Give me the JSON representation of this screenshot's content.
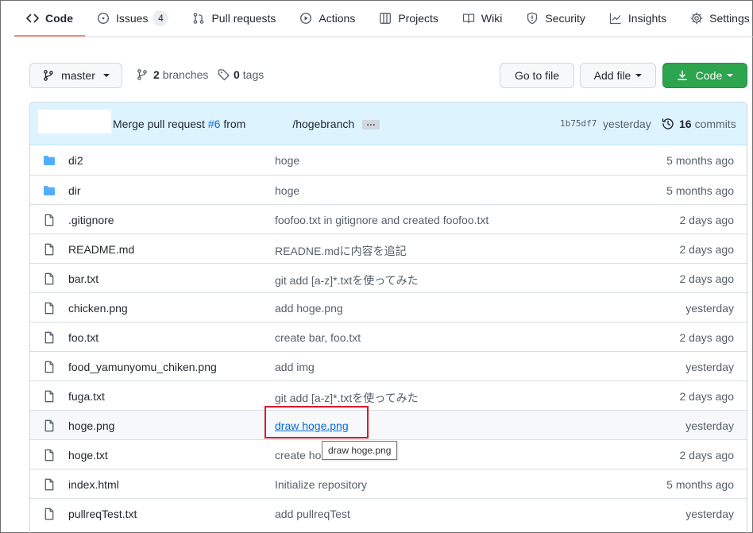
{
  "nav": {
    "tabs": [
      {
        "label": "Code",
        "icon": "code-icon",
        "active": true
      },
      {
        "label": "Issues",
        "icon": "issue-opened-icon",
        "count": "4"
      },
      {
        "label": "Pull requests",
        "icon": "git-pull-request-icon"
      },
      {
        "label": "Actions",
        "icon": "play-icon"
      },
      {
        "label": "Projects",
        "icon": "table-icon"
      },
      {
        "label": "Wiki",
        "icon": "book-icon"
      },
      {
        "label": "Security",
        "icon": "shield-icon"
      },
      {
        "label": "Insights",
        "icon": "graph-icon"
      },
      {
        "label": "Settings",
        "icon": "gear-icon"
      }
    ]
  },
  "toolbar": {
    "branch": "master",
    "branches_count": "2",
    "branches_label": "branches",
    "tags_count": "0",
    "tags_label": "tags",
    "go_to_file": "Go to file",
    "add_file": "Add file",
    "code": "Code"
  },
  "commit": {
    "message_prefix": "Merge pull request",
    "pr": "#6",
    "from": "from",
    "branch": "/hogebranch",
    "ellipsis": "…",
    "sha": "1b75df7",
    "when": "yesterday",
    "commits_count": "16",
    "commits_label": "commits"
  },
  "files": [
    {
      "type": "dir",
      "name": "di2",
      "message": "hoge",
      "age": "5 months ago"
    },
    {
      "type": "dir",
      "name": "dir",
      "message": "hoge",
      "age": "5 months ago"
    },
    {
      "type": "file",
      "name": ".gitignore",
      "message": "foofoo.txt in gitignore and created foofoo.txt",
      "age": "2 days ago"
    },
    {
      "type": "file",
      "name": "README.md",
      "message": "READNE.mdに内容を追記",
      "age": "2 days ago"
    },
    {
      "type": "file",
      "name": "bar.txt",
      "message": "git add [a-z]*.txtを使ってみた",
      "age": "2 days ago"
    },
    {
      "type": "file",
      "name": "chicken.png",
      "message": "add hoge.png",
      "age": "yesterday"
    },
    {
      "type": "file",
      "name": "foo.txt",
      "message": "create bar, foo.txt",
      "age": "2 days ago"
    },
    {
      "type": "file",
      "name": "food_yamunyomu_chiken.png",
      "message": "add img",
      "age": "yesterday"
    },
    {
      "type": "file",
      "name": "fuga.txt",
      "message": "git add [a-z]*.txtを使ってみた",
      "age": "2 days ago"
    },
    {
      "type": "file",
      "name": "hoge.png",
      "message": "draw hoge.png",
      "age": "yesterday"
    },
    {
      "type": "file",
      "name": "hoge.txt",
      "message": "create ho",
      "age": "2 days ago"
    },
    {
      "type": "file",
      "name": "index.html",
      "message": "Initialize repository",
      "age": "5 months ago"
    },
    {
      "type": "file",
      "name": "pullreqTest.txt",
      "message": "add pullreqTest",
      "age": "yesterday"
    }
  ],
  "tooltip": "draw hoge.png",
  "colors": {
    "accent": "#0969da",
    "green_button": "#2da44e",
    "highlight": "#e0142b",
    "folder": "#54aeff"
  }
}
